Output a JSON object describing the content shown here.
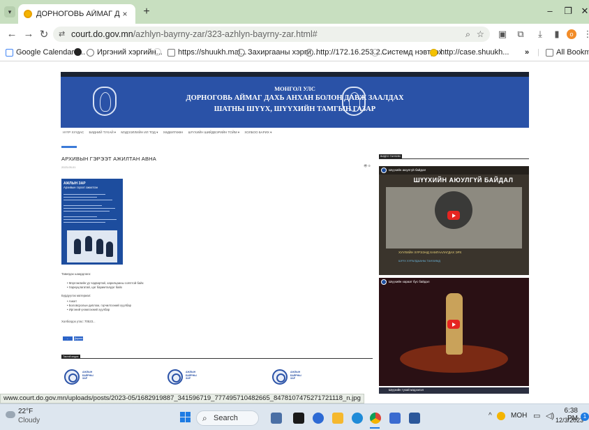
{
  "browser": {
    "tab_title": "ДОРНОГОВЬ АЙМАГ ДАХЬ Ш",
    "tab_close": "×",
    "new_tab": "+",
    "url_host": "court.do.gov.mn",
    "url_path": "/azhlyn-bayrny-zar/323-azhlyn-bayrny-zar.html#",
    "bookmarks": [
      "Google Calendar -...",
      "Иргэний хэргийн...",
      "https://shuukh.mai...",
      "Захиргааны хэрги...",
      "http://172.16.253.2...",
      "Системд нэвтрэх",
      "http://case.shuukh..."
    ],
    "bookmarks_more": "»",
    "all_bookmarks": "All Bookmarks",
    "status_url": "www.court.do.gov.mn/uploads/posts/2023-05/1682919887_341596719_777495710482665_8478107475271721118_n.jpg"
  },
  "site": {
    "banner_line1": "МОНГОЛ УЛС",
    "banner_line2": "ДОРНОГОВЬ АЙМАГ ДАХЬ АНХАН БОЛОН ДАВЖ ЗААЛДАХ",
    "banner_line3": "ШАТНЫ ШҮҮХ, ШҮҮХИЙН ТАМГЫН ГАЗАР",
    "menu": [
      "НҮҮР ХУУДАС",
      "БИДНИЙ ТУХАЙ ▾",
      "МЭДЭЭЛЛИЙН ИЛ ТОД ▾",
      "ХӨДӨЛГӨӨН",
      "ШҮҮХИЙН ШИЙДВЭРИЙН ТОЙМ ▾",
      "ХОЛБОО БАРИХ ▾"
    ],
    "page_title": "АРХИВЫН ГЭРЭЭТ АЖИЛТАН АВНА",
    "page_meta": "2023-05-01",
    "page_views": "👁 0",
    "poster": {
      "heading1": "АЖЛЫН ЗАР",
      "heading2": "Архивын гэрээт ажилтан"
    },
    "body_lines": [
      "Тавигдах шаардлага:",
      "• Мэргэжлийн ур чадвартай, харилцааны соёлтой байх",
      "• Хариуцлагатай, цаг баримталдаг байх",
      "Бүрдүүлэх материал:",
      "• Анкет",
      "• Боловсролын диплом, гэрчилгээний хуулбар",
      "• Иргэний үнэмлэхний хуулбар",
      "Холбогдох утас: 70523..."
    ],
    "btn_prev": "← Өмнөх",
    "btn_next": "Дараах",
    "related_label": "Төстэй мэдээ",
    "card_texts": [
      "АЖЛЫН БАЙРНЫ ЗАР",
      "АЖЛЫН БАЙРНЫ ЗАР",
      "АЖЛЫН БАЙРНЫ ЗАР"
    ],
    "video_label": "ВИДЕО ТАНХИМ",
    "video1_title": "Шүүхийн аюулгүй байдал",
    "video1_headline": "ШҮҮХИЙН АЮУЛГҮЙ БАЙДАЛ",
    "video1_cap1": "ХУУЛИЙН ХҮРЭЭНД ХАМГААЛАГДАХ ЭРХ",
    "video1_cap2": "ШҮҮХ ХУРАЛДААНЫ ТАНХИМД",
    "video2_title": "Шүүхийн хараат бус байдал",
    "video3_title": "Шүүхийн тухай мэдээлэл"
  },
  "taskbar": {
    "temp": "22°F",
    "weather": "Cloudy",
    "search": "Search",
    "lang": "МОН",
    "time": "6:38 PM",
    "date": "12/3/2023",
    "notif": "1"
  }
}
